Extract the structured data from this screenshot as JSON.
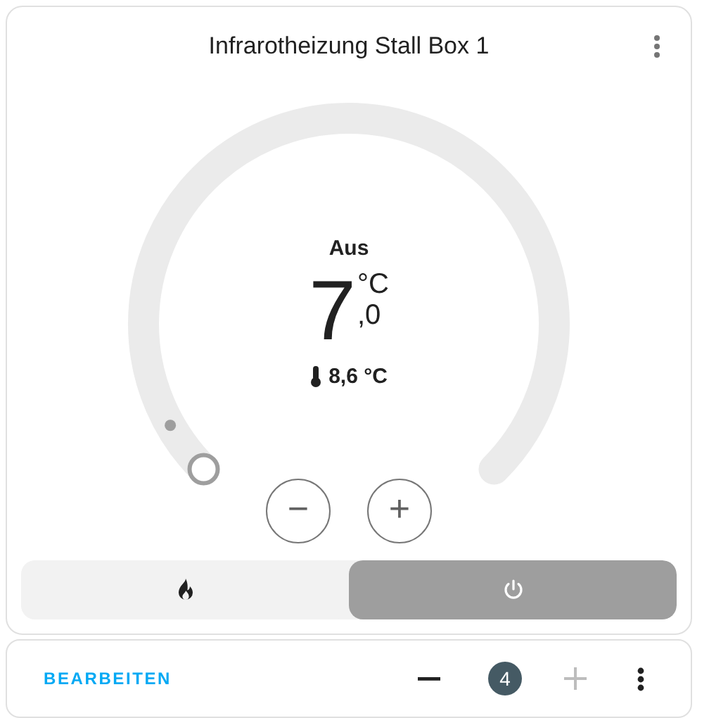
{
  "card": {
    "title": "Infrarotheizung Stall Box 1",
    "state": "Aus",
    "target": {
      "integer": "7",
      "unit": "°C",
      "decimal": ",0"
    },
    "current": {
      "text": "8,6 °C"
    },
    "controls": [
      "−",
      "+"
    ],
    "modes": [
      {
        "kind": "heat",
        "selected": false
      },
      {
        "kind": "off",
        "selected": true
      }
    ]
  },
  "footer": {
    "edit": "BEARBEITEN",
    "count": "4",
    "minus_disabled": false,
    "plus_disabled": true
  }
}
